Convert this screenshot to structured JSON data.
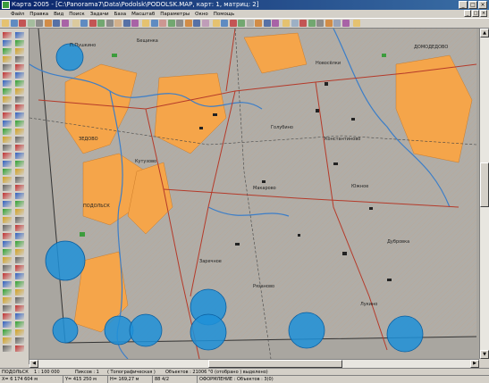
{
  "window": {
    "title": "Карта 2005 - [C:\\Panorama7\\Data\\Podolsk\\PODOLSK.MAP, карт: 1, матриц: 2]"
  },
  "menu": [
    "Файл",
    "Правка",
    "Вид",
    "Поиск",
    "Задачи",
    "База",
    "Масштаб",
    "Параметры",
    "Окно",
    "Помощь"
  ],
  "map_labels": {
    "ppushkino": "П.Пушкино",
    "beshchinka": "Бещинка",
    "zedovo": "ЗЕДОВО",
    "kutuzovo": "Кутузово",
    "podolsk": "ПОДОЛЬСК",
    "golubino": "Голубино",
    "makarovo": "Макарово",
    "novosyolki": "Новосёлки",
    "konstantinovo": "Константиново",
    "zarechnoe": "Заречное",
    "yuzhnoe": "Южное",
    "domodedovo": "ДОМОДЕДОВО",
    "dubrovka": "Дубровка",
    "ryazanovo": "Рязаново",
    "lukino": "Лукино"
  },
  "status": {
    "row1": {
      "map_name": "ПОДОЛЬСК",
      "scale": "1 : 100 000",
      "zoom": "Пиксов : 1",
      "map_type": "( Топографическая )",
      "objects": "Объектов : 21006 \"0 (отобрано ) выделено)"
    },
    "row2": {
      "x_coord": "X= 6 174 604 м",
      "y_coord": "Y= 415 250 м",
      "h_coord": "H= 169,27 м",
      "value": "88 4/2",
      "mode": "ОФОРМЛЕНИЕ : Объектов : 3(0)"
    }
  },
  "colors": {
    "title_bar": "#0a246a",
    "map_background": "#a9a6a0",
    "urban_fill": "#f5a54a",
    "water": "#3c7ec8",
    "highlight_circle": "#1e90d8",
    "road": "#b53a2a",
    "forest": "#3c9c3c"
  }
}
